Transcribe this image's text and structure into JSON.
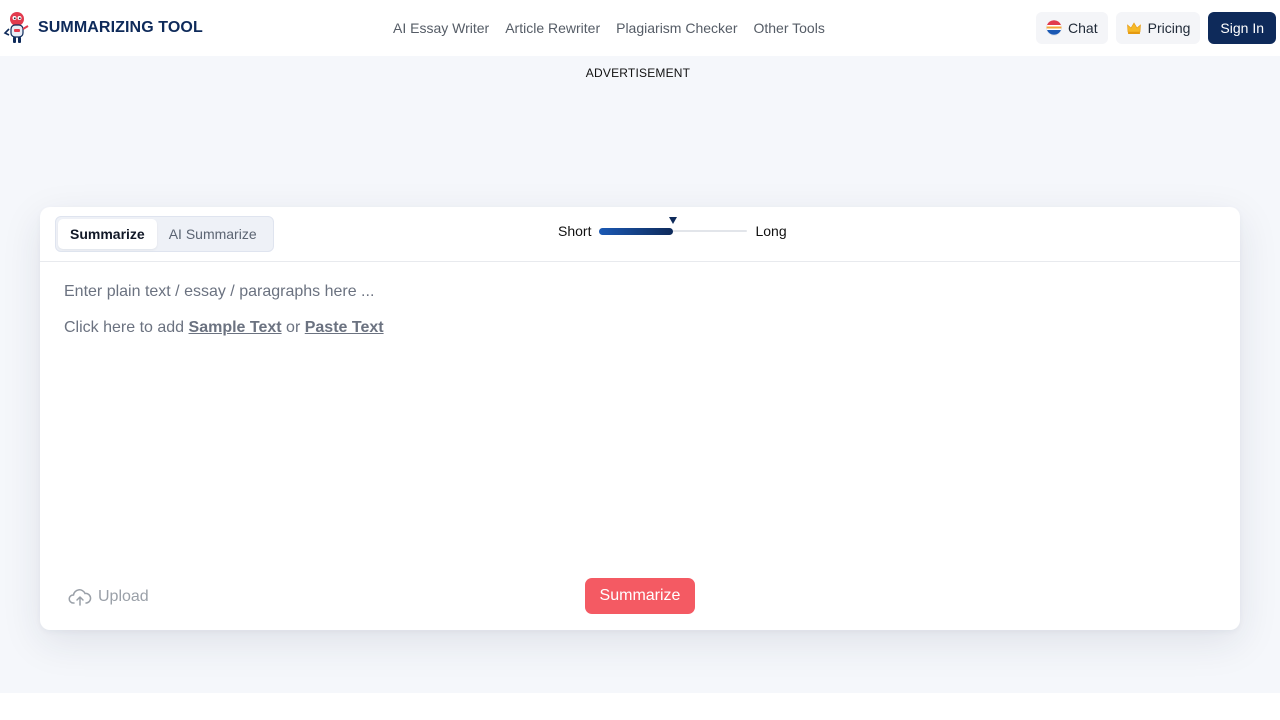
{
  "brand": {
    "name": "SUMMARIZING TOOL"
  },
  "nav": {
    "items": [
      {
        "label": "AI Essay Writer"
      },
      {
        "label": "Article Rewriter"
      },
      {
        "label": "Plagiarism Checker"
      },
      {
        "label": "Other Tools"
      }
    ]
  },
  "actions": {
    "chat": "Chat",
    "pricing": "Pricing",
    "signin": "Sign In"
  },
  "ad": {
    "label": "ADVERTISEMENT"
  },
  "tool": {
    "tabs": [
      {
        "label": "Summarize",
        "active": true
      },
      {
        "label": "AI Summarize",
        "active": false
      }
    ],
    "length": {
      "short_label": "Short",
      "long_label": "Long",
      "value": 0.5
    },
    "editor": {
      "placeholder": "Enter plain text / essay / paragraphs here ...",
      "prompt_prefix": "Click here to add",
      "sample_link": "Sample Text",
      "connector": "or",
      "paste_link": "Paste Text"
    },
    "upload_label": "Upload",
    "submit_label": "Summarize"
  },
  "colors": {
    "brand_navy": "#0e2a5a",
    "accent_red": "#f45a63",
    "background": "#f5f7fb"
  },
  "icons": [
    "logo-mascot-icon",
    "chat-flag-icon",
    "crown-icon",
    "upload-cloud-icon"
  ]
}
